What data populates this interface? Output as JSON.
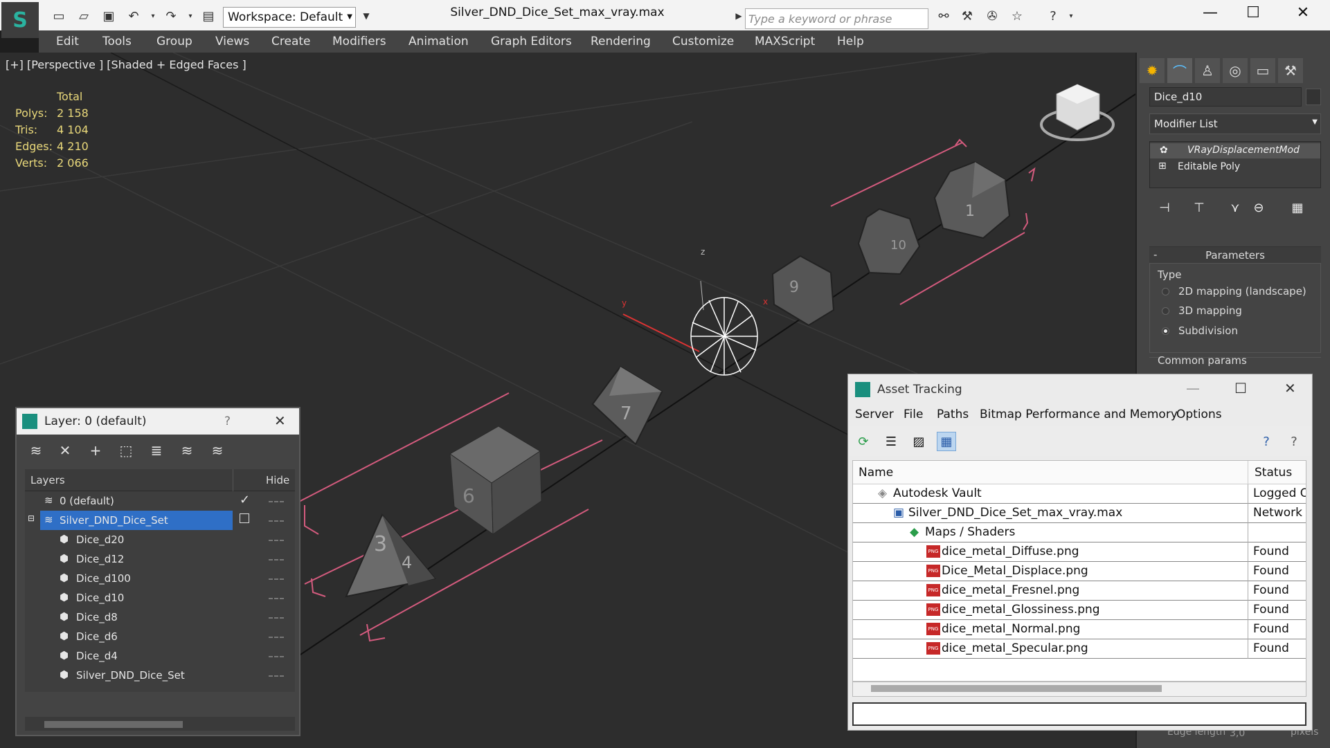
{
  "titlebar": {
    "workspace": "Workspace: Default",
    "title": "Silver_DND_Dice_Set_max_vray.max",
    "search_placeholder": "Type a keyword or phrase"
  },
  "menubar": [
    "Edit",
    "Tools",
    "Group",
    "Views",
    "Create",
    "Modifiers",
    "Animation",
    "Graph Editors",
    "Rendering",
    "Customize",
    "MAXScript",
    "Help"
  ],
  "viewport": {
    "label": "[+] [Perspective ] [Shaded + Edged Faces ]",
    "stats": {
      "header": "Total",
      "rows": [
        {
          "label": "Polys:",
          "value": "2 158"
        },
        {
          "label": "Tris:",
          "value": "4 104"
        },
        {
          "label": "Edges:",
          "value": "4 210"
        },
        {
          "label": "Verts:",
          "value": "2 066"
        }
      ]
    },
    "axis_labels": {
      "z": "z",
      "y": "y",
      "x": "x"
    }
  },
  "command_panel": {
    "object_name": "Dice_d10",
    "modifier_list": "Modifier List",
    "stack": [
      "VRayDisplacementMod",
      "Editable Poly"
    ],
    "parameters_title": "Parameters",
    "type_label": "Type",
    "type_options": [
      "2D mapping (landscape)",
      "3D mapping",
      "Subdivision"
    ],
    "selected_type": "Subdivision",
    "common_params": "Common params",
    "edge_length_label": "Edge length",
    "edge_length_value": "3,0",
    "edge_length_unit": "pixels"
  },
  "layer_panel": {
    "title": "Layer: 0 (default)",
    "help": "?",
    "col_layers": "Layers",
    "col_hide": "Hide",
    "rows": [
      {
        "name": "0 (default)",
        "indent": 0,
        "type": "layer",
        "selected": false,
        "current": true
      },
      {
        "name": "Silver_DND_Dice_Set",
        "indent": 0,
        "type": "layer",
        "selected": true,
        "current": false
      },
      {
        "name": "Dice_d20",
        "indent": 1,
        "type": "object",
        "selected": false,
        "current": false
      },
      {
        "name": "Dice_d12",
        "indent": 1,
        "type": "object",
        "selected": false,
        "current": false
      },
      {
        "name": "Dice_d100",
        "indent": 1,
        "type": "object",
        "selected": false,
        "current": false
      },
      {
        "name": "Dice_d10",
        "indent": 1,
        "type": "object",
        "selected": false,
        "current": false
      },
      {
        "name": "Dice_d8",
        "indent": 1,
        "type": "object",
        "selected": false,
        "current": false
      },
      {
        "name": "Dice_d6",
        "indent": 1,
        "type": "object",
        "selected": false,
        "current": false
      },
      {
        "name": "Dice_d4",
        "indent": 1,
        "type": "object",
        "selected": false,
        "current": false
      },
      {
        "name": "Silver_DND_Dice_Set",
        "indent": 1,
        "type": "object",
        "selected": false,
        "current": false
      }
    ]
  },
  "asset_tracking": {
    "title": "Asset Tracking",
    "menu": [
      "Server",
      "File",
      "Paths",
      "Bitmap Performance and Memory",
      "Options"
    ],
    "col_name": "Name",
    "col_status": "Status",
    "rows": [
      {
        "name": "Autodesk Vault",
        "status": "Logged O",
        "indent": 0,
        "icon": "vault"
      },
      {
        "name": "Silver_DND_Dice_Set_max_vray.max",
        "status": "Network P",
        "indent": 1,
        "icon": "max"
      },
      {
        "name": "Maps / Shaders",
        "status": "",
        "indent": 2,
        "icon": "maps"
      },
      {
        "name": "dice_metal_Diffuse.png",
        "status": "Found",
        "indent": 3,
        "icon": "png"
      },
      {
        "name": "Dice_Metal_Displace.png",
        "status": "Found",
        "indent": 3,
        "icon": "png"
      },
      {
        "name": "dice_metal_Fresnel.png",
        "status": "Found",
        "indent": 3,
        "icon": "png"
      },
      {
        "name": "dice_metal_Glossiness.png",
        "status": "Found",
        "indent": 3,
        "icon": "png"
      },
      {
        "name": "dice_metal_Normal.png",
        "status": "Found",
        "indent": 3,
        "icon": "png"
      },
      {
        "name": "dice_metal_Specular.png",
        "status": "Found",
        "indent": 3,
        "icon": "png"
      }
    ],
    "png_icon_text": "PNG"
  }
}
